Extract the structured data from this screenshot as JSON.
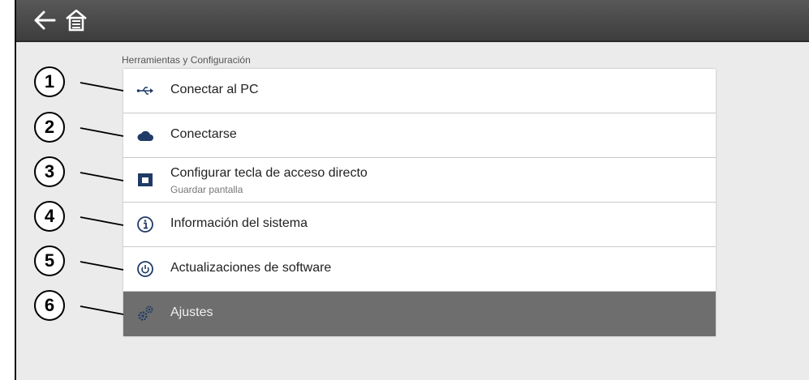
{
  "header": {
    "back_icon": "back-arrow-icon",
    "home_icon": "home-icon"
  },
  "section": {
    "label": "Herramientas y Configuración"
  },
  "menu": {
    "items": [
      {
        "title": "Conectar al PC",
        "subtitle": "",
        "icon": "usb-icon"
      },
      {
        "title": "Conectarse",
        "subtitle": "",
        "icon": "cloud-icon"
      },
      {
        "title": "Configurar tecla de acceso directo",
        "subtitle": "Guardar pantalla",
        "icon": "shortcut-key-icon"
      },
      {
        "title": "Información del sistema",
        "subtitle": "",
        "icon": "info-icon"
      },
      {
        "title": "Actualizaciones de software",
        "subtitle": "",
        "icon": "power-icon"
      },
      {
        "title": "Ajustes",
        "subtitle": "",
        "icon": "gears-icon",
        "selected": true
      }
    ]
  },
  "callouts": [
    "1",
    "2",
    "3",
    "4",
    "5",
    "6"
  ],
  "colors": {
    "accent_icon": "#1f3b66",
    "selected_row": "#6e6e6e",
    "topbar": "#4a4a4a",
    "background": "#ebebeb"
  }
}
